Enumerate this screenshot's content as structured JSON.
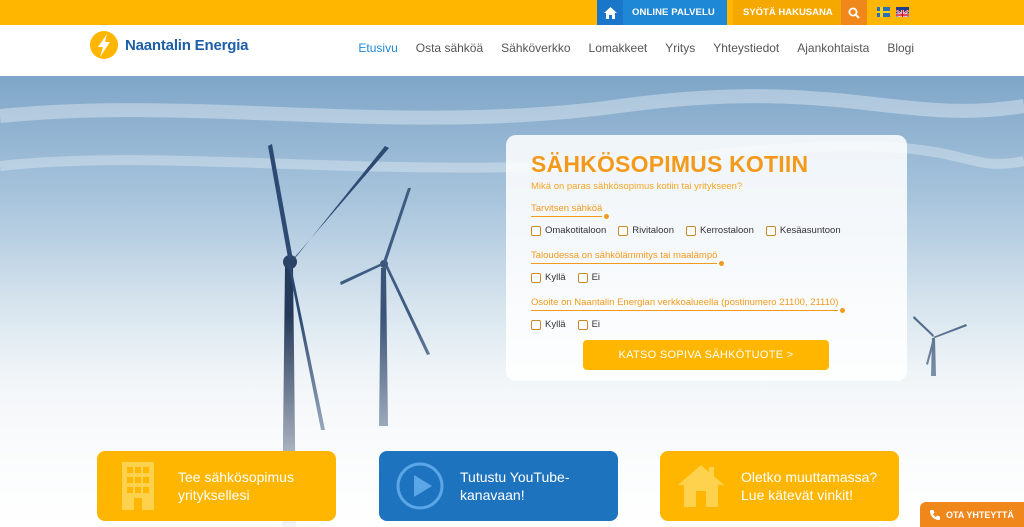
{
  "topbar": {
    "online_label": "ONLINE PALVELU",
    "search_placeholder": "SYÖTÄ HAKUSANA",
    "languages": [
      "sv",
      "en"
    ]
  },
  "header": {
    "logo_text": "Naantalin Energia",
    "nav": [
      "Etusivu",
      "Osta sähköä",
      "Sähköverkko",
      "Lomakkeet",
      "Yritys",
      "Yhteystiedot",
      "Ajankohtaista",
      "Blogi"
    ],
    "active_nav": "Etusivu"
  },
  "form": {
    "title": "SÄHKÖSOPIMUS KOTIIN",
    "subtitle": "Mikä on paras sähkösopimus kotiin tai yritykseen?",
    "q1": "Tarvitsen sähköä",
    "q1_options": [
      "Omakotitaloon",
      "Rivitaloon",
      "Kerrostaloon",
      "Kesäasuntoon"
    ],
    "q2": "Taloudessa on sähkölämmitys tai maalämpö",
    "q2_options": [
      "Kyllä",
      "Ei"
    ],
    "q3": "Osoite on Naantalin Energian verkkoalueella (postinumero 21100, 21110)",
    "q3_options": [
      "Kyllä",
      "Ei"
    ],
    "cta": "KATSO SOPIVA SÄHKÖTUOTE >"
  },
  "tiles": [
    {
      "text_1": "Tee sähkösopimus",
      "text_2": "yrityksellesi",
      "icon": "building-icon"
    },
    {
      "text_1": "Tutustu YouTube-",
      "text_2": "kanavaan!",
      "icon": "play-icon"
    },
    {
      "text_1": "Oletko muuttamassa?",
      "text_2": "Lue kätevät vinkit!",
      "icon": "house-icon"
    }
  ],
  "contact": {
    "label": "OTA YHTEYTTÄ",
    "icon": "phone-icon"
  },
  "colors": {
    "brand_yellow": "#ffb600",
    "brand_orange": "#f39a1c",
    "brand_blue": "#1e73be"
  }
}
